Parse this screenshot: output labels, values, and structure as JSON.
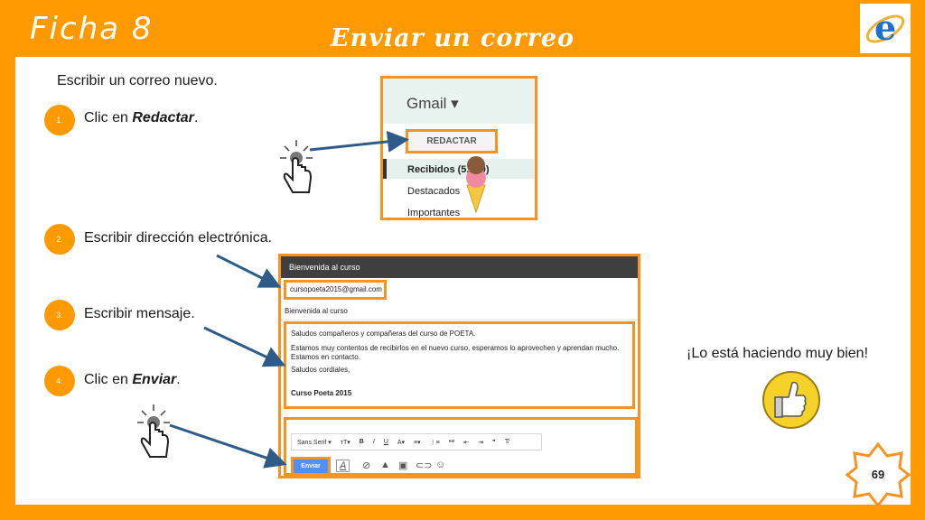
{
  "header": {
    "sheet_title": "Ficha 8",
    "main_title": "Enviar un correo",
    "browser_icon": "internet-explorer-icon"
  },
  "intro": "Escribir un correo nuevo.",
  "steps": [
    {
      "num": "1.",
      "pre": "Clic en ",
      "bold": "Redactar",
      "post": "."
    },
    {
      "num": "2.",
      "text": "Escribir dirección electrónica."
    },
    {
      "num": "3.",
      "text": "Escribir mensaje."
    },
    {
      "num": "4.",
      "pre": "Clic en ",
      "bold": "Enviar",
      "post": "."
    }
  ],
  "gmail": {
    "logo": "Gmail ▾",
    "compose_button": "REDACTAR",
    "nav": [
      "Recibidos (5,250)",
      "Destacados",
      "Importantes"
    ]
  },
  "compose": {
    "header": "Bienvenida al curso",
    "to": "cursopoeta2015@gmail.com",
    "subject": "Bienvenida al curso",
    "body": {
      "line1": "Saludos compañeros y compañeras del curso de POETA.",
      "line2": "Estamos muy contentos de recibirlos en el nuevo curso, esperamos lo aprovechen y aprendan mucho.",
      "line3": "Estamos en contacto.",
      "line4": "Saludos cordiales,",
      "signature": "Curso Poeta 2015"
    },
    "font": "Sans Serif ▾",
    "send_button": "Enviar"
  },
  "praise": "¡Lo está haciendo muy bien!",
  "page_number": "69",
  "colors": {
    "accent": "#ff9900",
    "border": "#f7931e",
    "arrow": "#2e5b8a",
    "gmail_blue": "#4d90fe"
  }
}
